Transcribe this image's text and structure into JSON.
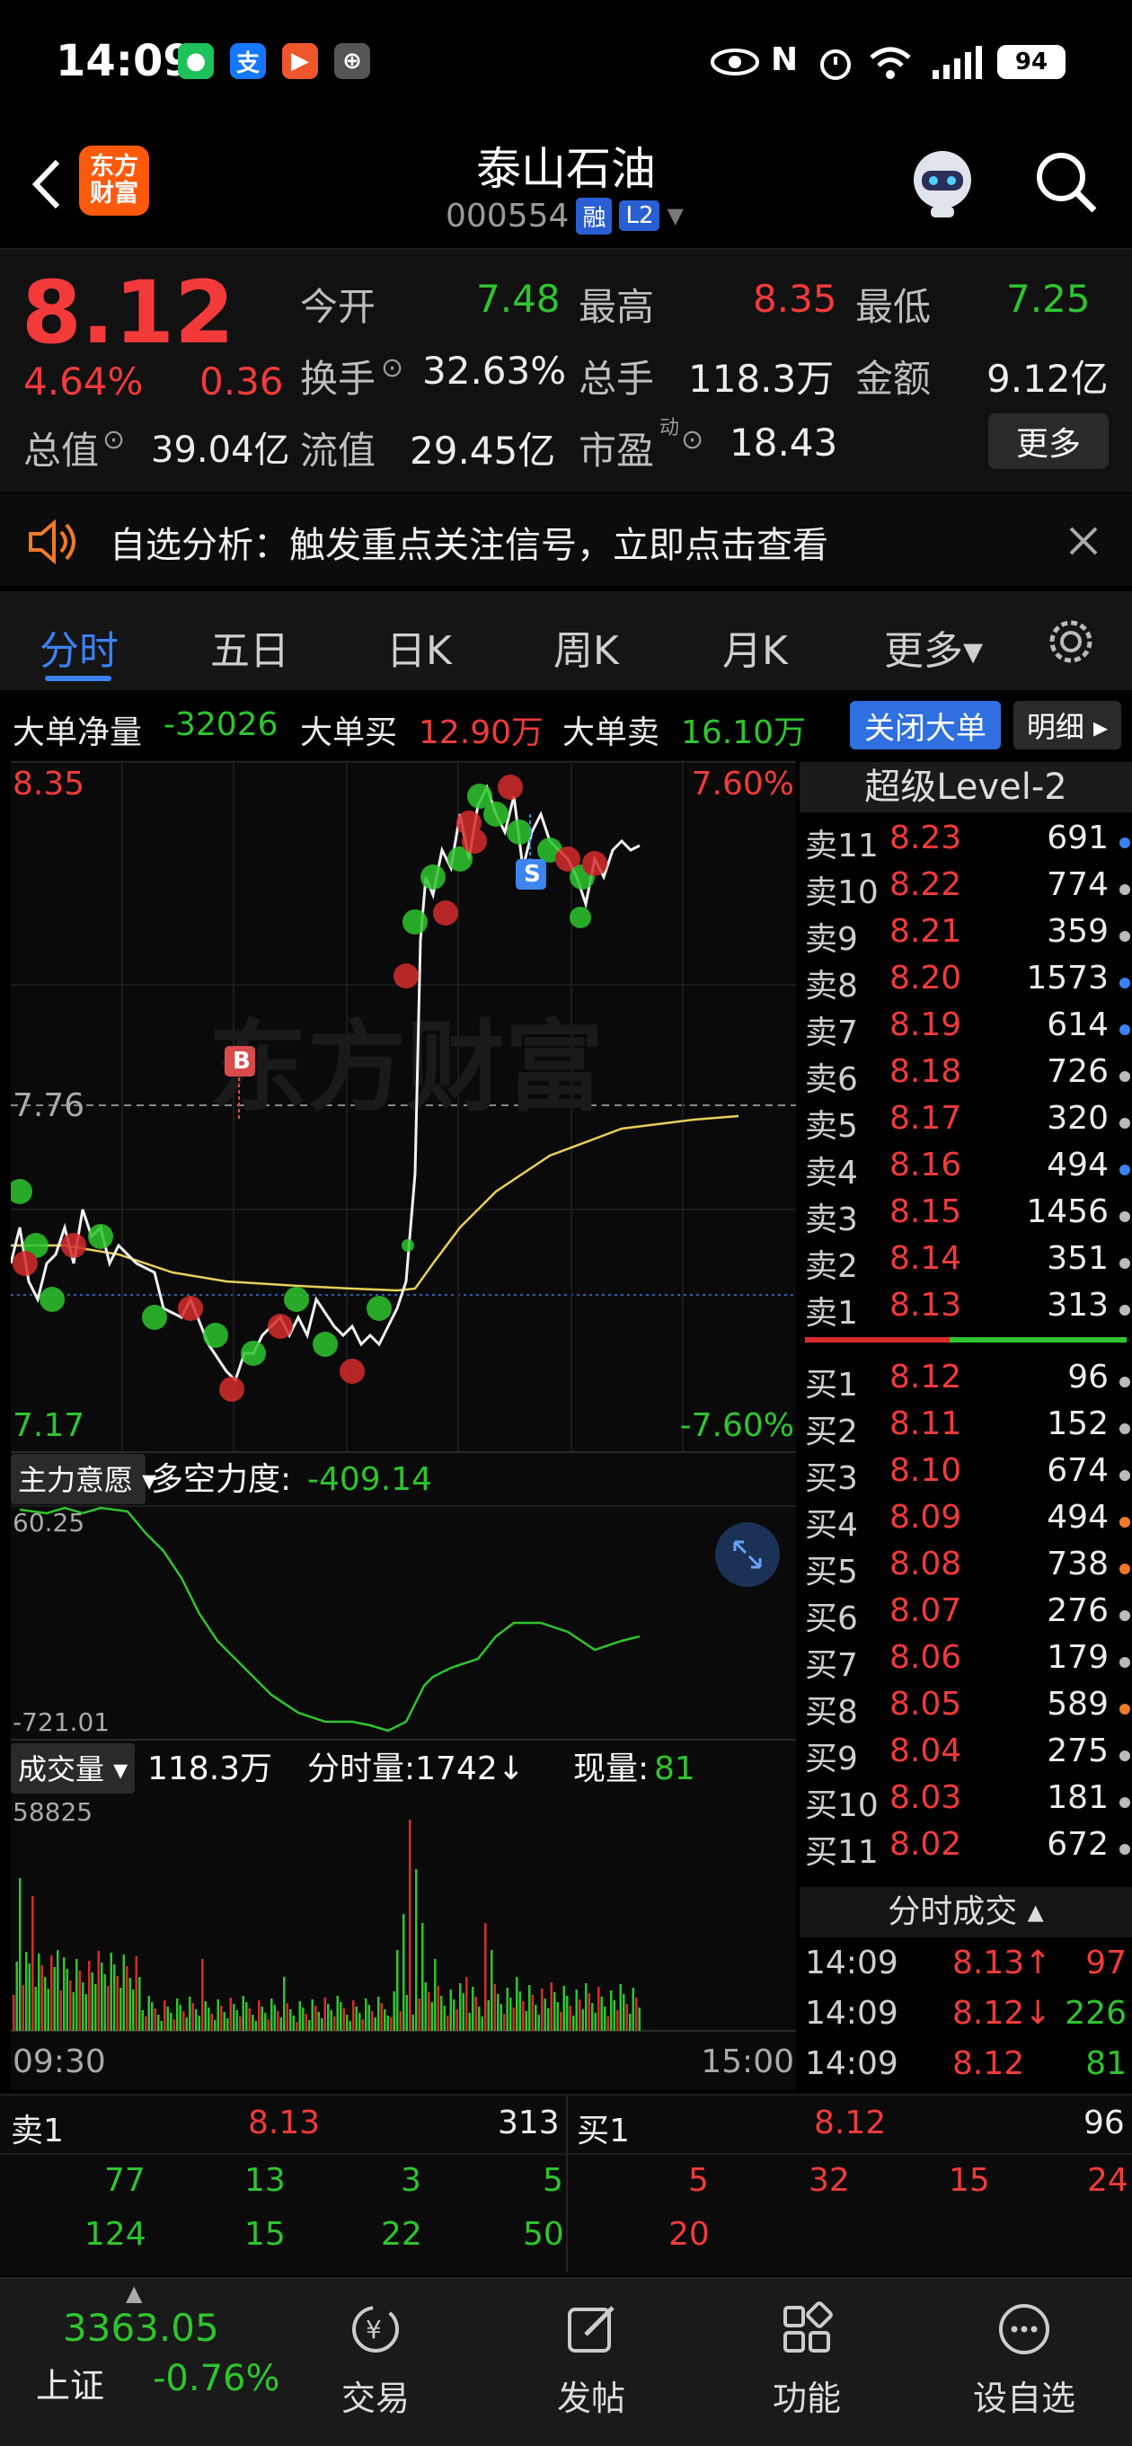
{
  "status_bar": {
    "time": "14:09",
    "apps": [
      {
        "icon": "wechat-icon",
        "glyph": "●",
        "color": "#1dc25b"
      },
      {
        "icon": "alipay-icon",
        "glyph": "支",
        "color": "#1677ff"
      },
      {
        "icon": "app-icon",
        "glyph": "▶",
        "color": "#f0562b"
      },
      {
        "icon": "app2-icon",
        "glyph": "⊕",
        "color": "#555555"
      }
    ],
    "battery": "94"
  },
  "header": {
    "logo_line1": "东方",
    "logo_line2": "财富",
    "stock_name": "泰山石油",
    "stock_code": "000554",
    "badge_margin": "融",
    "badge_level": "L2"
  },
  "quote": {
    "price": "8.12",
    "change_pct": "4.64%",
    "change_amt": "0.36",
    "open_label": "今开",
    "open": "7.48",
    "high_label": "最高",
    "high": "8.35",
    "low_label": "最低",
    "low": "7.25",
    "turnover_label": "换手",
    "turnover": "32.63%",
    "volume_label": "总手",
    "volume": "118.3万",
    "amount_label": "金额",
    "amount": "9.12亿",
    "mcap_label": "总值",
    "mcap": "39.04亿",
    "float_label": "流值",
    "float_cap": "29.45亿",
    "pe_label": "市盈",
    "pe_sup": "动",
    "pe": "18.43",
    "more_button": "更多"
  },
  "notice": {
    "text": "自选分析：触发重点关注信号，立即点击查看"
  },
  "tabs": [
    "分时",
    "五日",
    "日K",
    "周K",
    "月K",
    "更多▾"
  ],
  "big_orders": {
    "net_label": "大单净量",
    "net": "-32026",
    "buy_label": "大单买",
    "buy": "12.90万",
    "sell_label": "大单卖",
    "sell": "16.10万",
    "close_button": "关闭大单",
    "detail_button": "明细 ▸"
  },
  "intraday": {
    "top_price": "8.35",
    "top_pct": "7.60%",
    "mid_price": "7.76",
    "bottom_price": "7.17",
    "bottom_pct": "-7.60%",
    "watermark": "东方财富",
    "marker_buy": "B",
    "marker_sell": "S"
  },
  "indicator": {
    "selector": "主力意愿 ▾",
    "name": "多空力度:",
    "value": "-409.14",
    "top_value": "60.25",
    "bottom_value": "-721.01"
  },
  "volume_panel": {
    "selector": "成交量 ▾",
    "total": "118.3万",
    "minute_label": "分时量:1742↓",
    "current_label": "现量:",
    "current": "81",
    "max_value": "58825",
    "time_start": "09:30",
    "time_end": "15:00"
  },
  "order_book": {
    "title": "超级Level-2",
    "asks": [
      {
        "label": "卖11",
        "price": "8.23",
        "vol": "691",
        "dot": "#3a82f6"
      },
      {
        "label": "卖10",
        "price": "8.22",
        "vol": "774",
        "dot": "#bbbbbb"
      },
      {
        "label": "卖9",
        "price": "8.21",
        "vol": "359",
        "dot": "#bbbbbb"
      },
      {
        "label": "卖8",
        "price": "8.20",
        "vol": "1573",
        "dot": "#3a82f6"
      },
      {
        "label": "卖7",
        "price": "8.19",
        "vol": "614",
        "dot": "#3a82f6"
      },
      {
        "label": "卖6",
        "price": "8.18",
        "vol": "726",
        "dot": "#bbbbbb"
      },
      {
        "label": "卖5",
        "price": "8.17",
        "vol": "320",
        "dot": "#bbbbbb"
      },
      {
        "label": "卖4",
        "price": "8.16",
        "vol": "494",
        "dot": "#3a82f6"
      },
      {
        "label": "卖3",
        "price": "8.15",
        "vol": "1456",
        "dot": "#bbbbbb"
      },
      {
        "label": "卖2",
        "price": "8.14",
        "vol": "351",
        "dot": "#bbbbbb"
      },
      {
        "label": "卖1",
        "price": "8.13",
        "vol": "313",
        "dot": "#bbbbbb"
      }
    ],
    "bids": [
      {
        "label": "买1",
        "price": "8.12",
        "vol": "96",
        "dot": "#bbbbbb"
      },
      {
        "label": "买2",
        "price": "8.11",
        "vol": "152",
        "dot": "#bbbbbb"
      },
      {
        "label": "买3",
        "price": "8.10",
        "vol": "674",
        "dot": "#bbbbbb"
      },
      {
        "label": "买4",
        "price": "8.09",
        "vol": "494",
        "dot": "#f07a2a"
      },
      {
        "label": "买5",
        "price": "8.08",
        "vol": "738",
        "dot": "#f07a2a"
      },
      {
        "label": "买6",
        "price": "8.07",
        "vol": "276",
        "dot": "#bbbbbb"
      },
      {
        "label": "买7",
        "price": "8.06",
        "vol": "179",
        "dot": "#bbbbbb"
      },
      {
        "label": "买8",
        "price": "8.05",
        "vol": "589",
        "dot": "#f07a2a"
      },
      {
        "label": "买9",
        "price": "8.04",
        "vol": "275",
        "dot": "#bbbbbb"
      },
      {
        "label": "买10",
        "price": "8.03",
        "vol": "181",
        "dot": "#bbbbbb"
      },
      {
        "label": "买11",
        "price": "8.02",
        "vol": "672",
        "dot": "#bbbbbb"
      }
    ],
    "trades_title": "分时成交 ▴",
    "trades": [
      {
        "time": "14:09",
        "price": "8.13↑",
        "vol": "97",
        "pc": "#f23a3a",
        "vc": "#f23a3a"
      },
      {
        "time": "14:09",
        "price": "8.12↓",
        "vol": "226",
        "pc": "#f23a3a",
        "vc": "#2ec52e"
      },
      {
        "time": "14:09",
        "price": "8.12",
        "vol": "81",
        "pc": "#f23a3a",
        "vc": "#2ec52e"
      }
    ]
  },
  "mini_book": {
    "ask_label": "卖1",
    "ask_price": "8.13",
    "ask_vol": "313",
    "bid_label": "买1",
    "bid_price": "8.12",
    "bid_vol": "96",
    "ask_queue_1": [
      "77",
      "13",
      "3",
      "5"
    ],
    "ask_queue_2": [
      "124",
      "15",
      "22",
      "50"
    ],
    "bid_queue_1": [
      "5",
      "32",
      "15",
      "24"
    ],
    "bid_queue_2": [
      "20"
    ]
  },
  "bottom_nav": {
    "index_value": "3363.05",
    "index_name": "上证",
    "index_change": "-0.76%",
    "items": [
      {
        "label": "交易",
        "icon": "trade-icon"
      },
      {
        "label": "发帖",
        "icon": "compose-icon"
      },
      {
        "label": "功能",
        "icon": "functions-icon"
      },
      {
        "label": "设自选",
        "icon": "add-watchlist-icon"
      }
    ]
  },
  "colors": {
    "up": "#f23a3a",
    "down": "#2ec52e",
    "accent": "#2f6fe0"
  }
}
